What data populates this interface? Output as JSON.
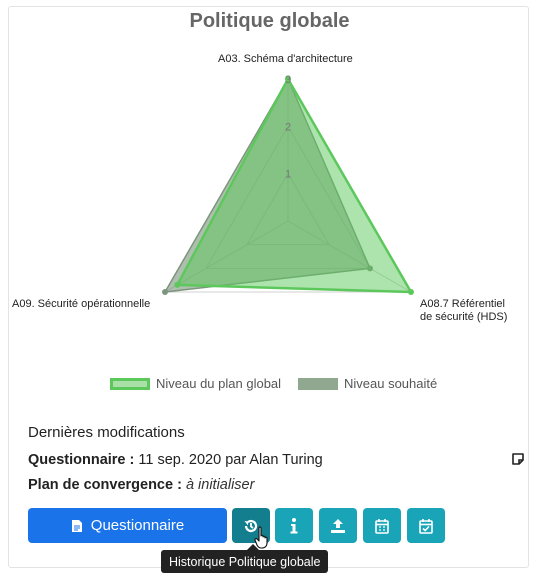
{
  "chart_data": {
    "type": "radar",
    "title": "Politique globale",
    "axes": [
      "A03. Schéma d'architecture",
      "A08.7 Référentiel de sécurité (HDS)",
      "A09. Sécurité opérationnelle"
    ],
    "axis_label_lines": [
      [
        "A03. Schéma d'architecture"
      ],
      [
        "A08.7 Référentiel",
        "de sécurité (HDS)"
      ],
      [
        "A09. Sécurité opérationnelle"
      ]
    ],
    "scale": {
      "min": 0,
      "max": 3,
      "ticks": [
        "1",
        "2",
        "3"
      ]
    },
    "series": [
      {
        "name": "Niveau du plan global",
        "values": [
          3,
          3,
          2.7
        ],
        "color": "#5cc85c"
      },
      {
        "name": "Niveau souhaité",
        "values": [
          3,
          2,
          3
        ],
        "color": "#6e8b6e"
      }
    ],
    "legend_position": "bottom"
  },
  "section": {
    "title": "Dernières modifications",
    "questionnaire_label": "Questionnaire :",
    "questionnaire_value": "11 sep. 2020 par Alan Turing",
    "plan_label": "Plan de convergence :",
    "plan_value": "à initialiser"
  },
  "buttons": {
    "questionnaire_label": "Questionnaire",
    "icons": [
      "history-icon",
      "info-icon",
      "upload-icon",
      "calendar-icon",
      "calendar-check-icon"
    ]
  },
  "tooltip": {
    "text": "Historique Politique globale"
  },
  "colors": {
    "primary": "#1a73e8",
    "teal": "#1aa4b8",
    "teal_active": "#137e8d"
  }
}
